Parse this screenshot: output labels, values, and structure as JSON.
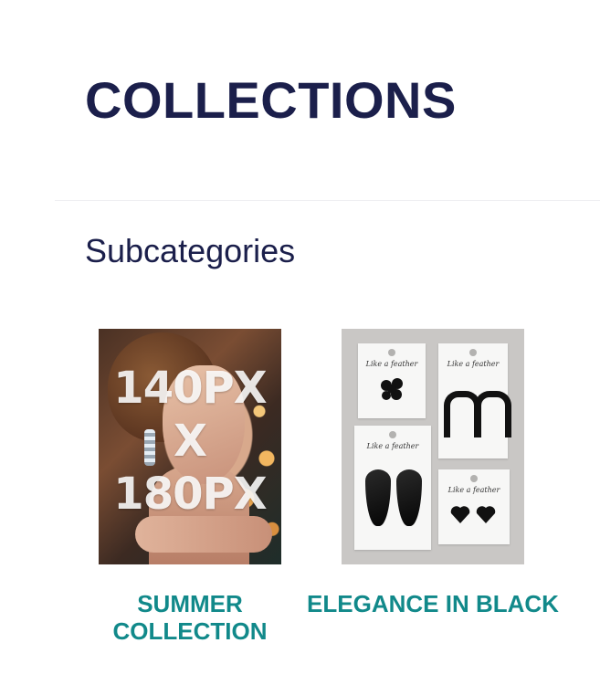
{
  "header": {
    "title": "COLLECTIONS"
  },
  "subcategories": {
    "heading": "Subcategories",
    "items": [
      {
        "label": "SUMMER COLLECTION",
        "image_text": [
          "140PX",
          "X",
          "180PX"
        ]
      },
      {
        "label": "ELEGANCE IN BLACK",
        "card_script": "Like a feather"
      }
    ]
  },
  "colors": {
    "title": "#1b1f4b",
    "accent": "#11898a",
    "divider": "#efeff2"
  }
}
